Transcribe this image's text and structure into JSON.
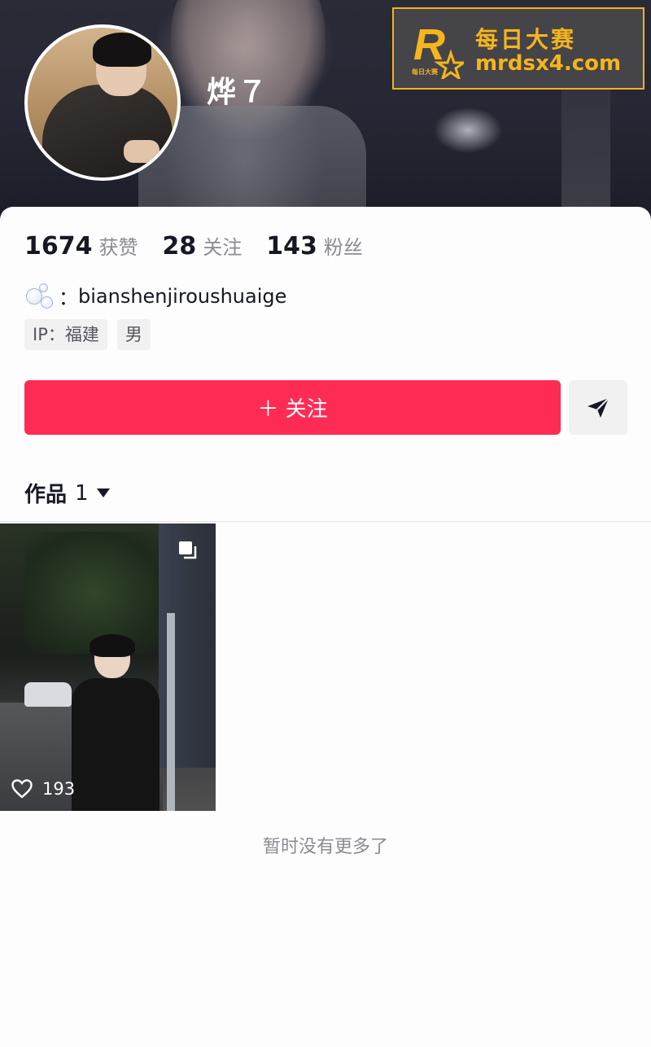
{
  "profile": {
    "username": "烨７",
    "handle_prefix": "：",
    "handle": "bianshenjiroushuaige",
    "stats": [
      {
        "value": "1674",
        "label": "获赞"
      },
      {
        "value": "28",
        "label": "关注"
      },
      {
        "value": "143",
        "label": "粉丝"
      }
    ],
    "tags": [
      "IP：福建",
      "男"
    ]
  },
  "actions": {
    "follow_label": "＋ 关注",
    "message_icon": "send-icon"
  },
  "works_tab": {
    "label": "作品",
    "count": "1"
  },
  "posts": [
    {
      "likes": "193",
      "icon": "heart-icon",
      "type_icon": "multi-image-icon"
    }
  ],
  "footer": {
    "no_more_text": "暂时没有更多了"
  },
  "watermark": {
    "title": "每日大赛",
    "url": "mrdsx4.com",
    "logo_letter": "R",
    "logo_sub": "每日大赛"
  },
  "colors": {
    "accent": "#fe2c55",
    "watermark": "#f5b51c",
    "text_primary": "#161823",
    "text_secondary": "#8a8b91"
  }
}
